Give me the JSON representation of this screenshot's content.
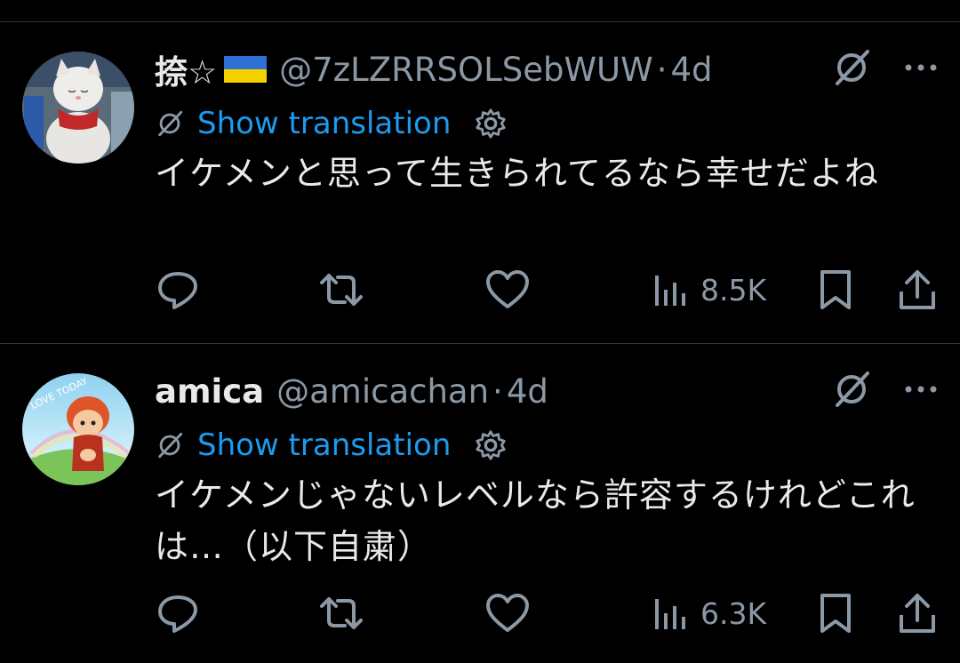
{
  "tweets": [
    {
      "name": "捺☆",
      "has_flag": true,
      "handle": "@7zLZRRSOLSebWUW",
      "separator": "·",
      "time": "4d",
      "translate_label": "Show translation",
      "body": "イケメンと思って生きられてるなら幸せだよね",
      "views": "8.5K",
      "avatar": "cat-avatar"
    },
    {
      "name": "amica",
      "has_flag": false,
      "handle": "@amicachan",
      "separator": "·",
      "time": "4d",
      "translate_label": "Show translation",
      "body": "イケメンじゃないレベルなら許容するけれどこれは…（以下自粛）",
      "views": "6.3K",
      "avatar": "anime-avatar",
      "avatar_text": "LOVE TODAY"
    }
  ],
  "icons": {
    "grok": "grok-icon",
    "more": "more-icon",
    "translate": "translate-icon",
    "settings": "gear-icon",
    "reply": "reply-icon",
    "retweet": "retweet-icon",
    "like": "heart-icon",
    "views": "views-icon",
    "bookmark": "bookmark-icon",
    "share": "share-icon"
  },
  "colors": {
    "background": "#000000",
    "text": "#e7e9ea",
    "muted": "#8b98a5",
    "link": "#1d9bf0",
    "divider": "#2f3336"
  }
}
